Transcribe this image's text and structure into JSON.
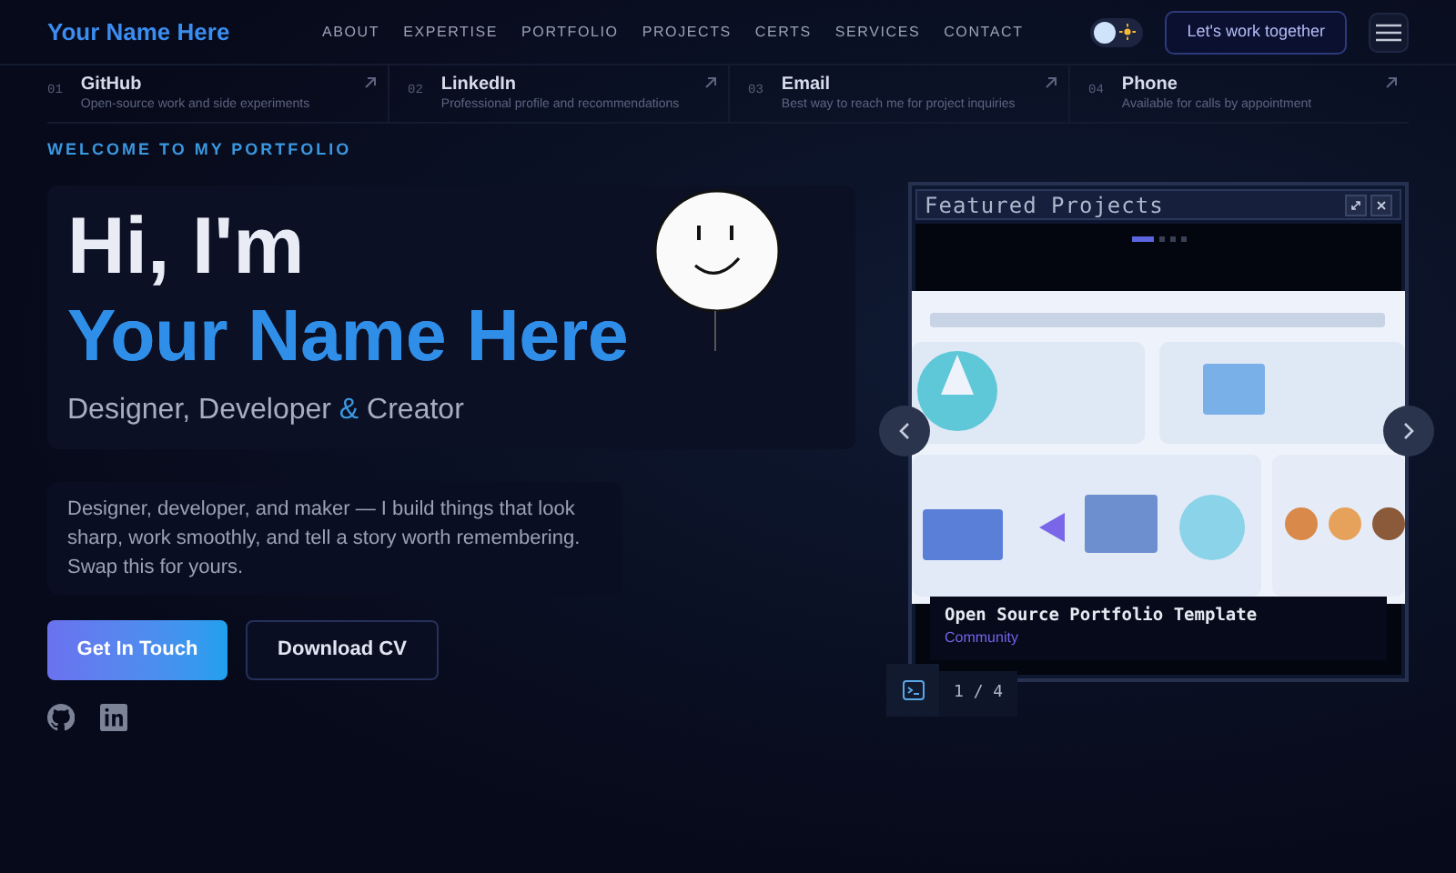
{
  "brand": "Your Name Here",
  "nav": [
    "ABOUT",
    "EXPERTISE",
    "PORTFOLIO",
    "PROJECTS",
    "CERTS",
    "SERVICES",
    "CONTACT"
  ],
  "theme_toggle": {
    "on": false
  },
  "cta": "Let's work together",
  "links": [
    {
      "index": "01",
      "title": "GitHub",
      "subtitle": "Open-source work and side experiments"
    },
    {
      "index": "02",
      "title": "LinkedIn",
      "subtitle": "Professional profile and recommendations"
    },
    {
      "index": "03",
      "title": "Email",
      "subtitle": "Best way to reach me for project inquiries"
    },
    {
      "index": "04",
      "title": "Phone",
      "subtitle": "Available for calls by appointment"
    }
  ],
  "eyebrow": "WELCOME TO MY PORTFOLIO",
  "greeting": "Hi, I'm",
  "name": "Your Name Here",
  "tagline": "Designer, Developer **&** Creator",
  "bio": "Designer, developer, and maker — I build things that look sharp, work smoothly, and tell a story worth remembering. Swap this for yours.",
  "buttons": [
    {
      "label": "Get In Touch",
      "kind": "primary"
    },
    {
      "label": "Download CV",
      "kind": "outline"
    }
  ],
  "socials": [
    {
      "kind": "github"
    },
    {
      "kind": "linkedin"
    }
  ],
  "featured": {
    "title": "Featured Projects",
    "slides": [
      {
        "selected": true
      },
      {
        "selected": false
      },
      {
        "selected": false
      },
      {
        "selected": false
      }
    ],
    "caption": "Open Source Portfolio Template",
    "category": "Community",
    "counter": "1 / 4"
  }
}
